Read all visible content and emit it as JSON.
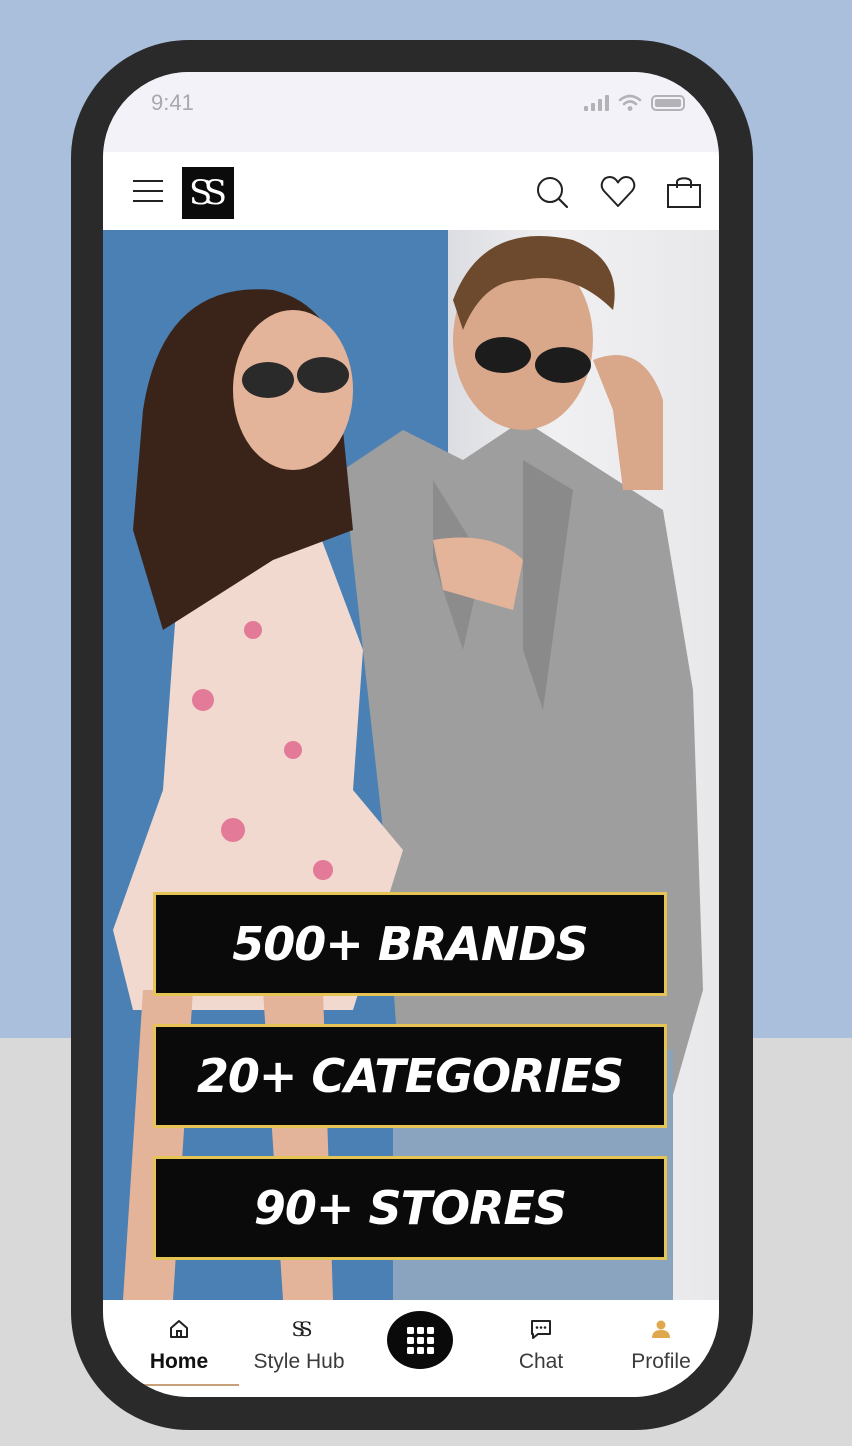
{
  "status_bar": {
    "time": "9:41"
  },
  "header": {
    "logo_text": "SS"
  },
  "hero": {
    "stats": [
      {
        "label": "500+ BRANDS"
      },
      {
        "label": "20+ CATEGORIES"
      },
      {
        "label": "90+ STORES"
      }
    ]
  },
  "bottom_nav": {
    "items": [
      {
        "label": "Home",
        "icon": "home-icon",
        "active": true
      },
      {
        "label": "Style Hub",
        "icon": "stylehub-logo-icon",
        "active": false
      },
      {
        "label": "Chat",
        "icon": "chat-icon",
        "active": false
      },
      {
        "label": "Profile",
        "icon": "profile-icon",
        "active": false
      }
    ],
    "center_button_icon": "grid-icon"
  },
  "colors": {
    "page_top": "#aabfdc",
    "page_bottom": "#d9d9da",
    "phone_frame": "#2a2a2a",
    "stat_border": "#e5c454",
    "stat_bg": "#0a0a0a",
    "profile_accent": "#e0a84c",
    "active_underline": "#c8a07a"
  }
}
